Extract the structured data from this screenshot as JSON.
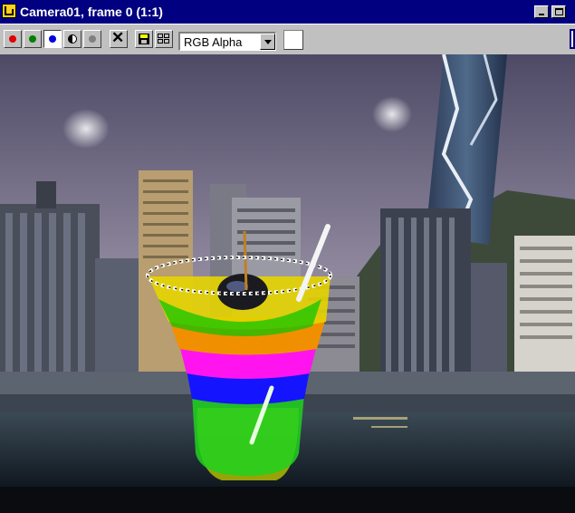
{
  "window": {
    "title": "Camera01, frame 0 (1:1)",
    "controls": [
      "minimize",
      "maximize"
    ]
  },
  "toolbar": {
    "channel_buttons": [
      {
        "name": "red-channel",
        "color": "#e00000",
        "pressed": false
      },
      {
        "name": "green-channel",
        "color": "#008000",
        "pressed": false
      },
      {
        "name": "blue-channel",
        "color": "#0000e0",
        "pressed": true
      },
      {
        "name": "alpha-channel",
        "icon": "half-circle-icon",
        "pressed": false
      },
      {
        "name": "mono-channel",
        "color": "#808080",
        "pressed": false
      }
    ],
    "clear_icon": "close-x-icon",
    "save_icon": "save-disk-icon",
    "clone_icon": "clone-window-icon",
    "channel_select": {
      "value": "RGB Alpha"
    },
    "background_swatch_color": "#ffffff"
  },
  "render": {
    "description_icon": "rendered-frame",
    "sky_top": "#4e4a66",
    "sky_bottom": "#aaa2b6",
    "water": "#1e2a3a",
    "cup_layers": [
      "#ffd000",
      "#f08a00",
      "#ff00ff",
      "#0000ff",
      "#00d400"
    ]
  }
}
